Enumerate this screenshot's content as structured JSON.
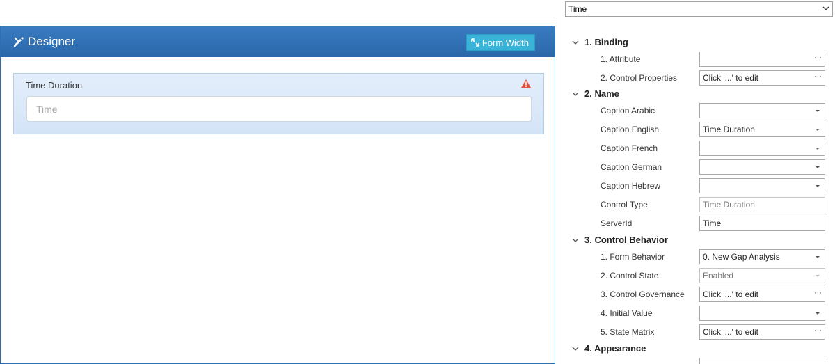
{
  "designer": {
    "title": "Designer",
    "form_width_label": "Form Width",
    "field": {
      "label": "Time Duration",
      "placeholder": "Time"
    }
  },
  "panel": {
    "top_select": "Time",
    "sections": [
      {
        "label": "1. Binding"
      },
      {
        "label": "2. Name"
      },
      {
        "label": "3. Control Behavior"
      },
      {
        "label": "4. Appearance"
      }
    ],
    "rows": [
      {
        "label": "1. Attribute",
        "value": ""
      },
      {
        "label": "2. Control Properties",
        "value": "Click '...' to edit"
      },
      {
        "label": "Caption Arabic",
        "value": ""
      },
      {
        "label": "Caption English",
        "value": "Time Duration"
      },
      {
        "label": "Caption French",
        "value": ""
      },
      {
        "label": "Caption German",
        "value": ""
      },
      {
        "label": "Caption Hebrew",
        "value": ""
      },
      {
        "label": "Control Type",
        "value": "Time Duration"
      },
      {
        "label": "ServerId",
        "value": "Time"
      },
      {
        "label": "1. Form Behavior",
        "value": "0. New Gap Analysis"
      },
      {
        "label": "2. Control State",
        "value": "Enabled"
      },
      {
        "label": "3. Control Governance",
        "value": "Click '...' to edit"
      },
      {
        "label": "4. Initial Value",
        "value": ""
      },
      {
        "label": "5. State Matrix",
        "value": "Click '...' to edit"
      }
    ],
    "ellipsis": "···"
  }
}
